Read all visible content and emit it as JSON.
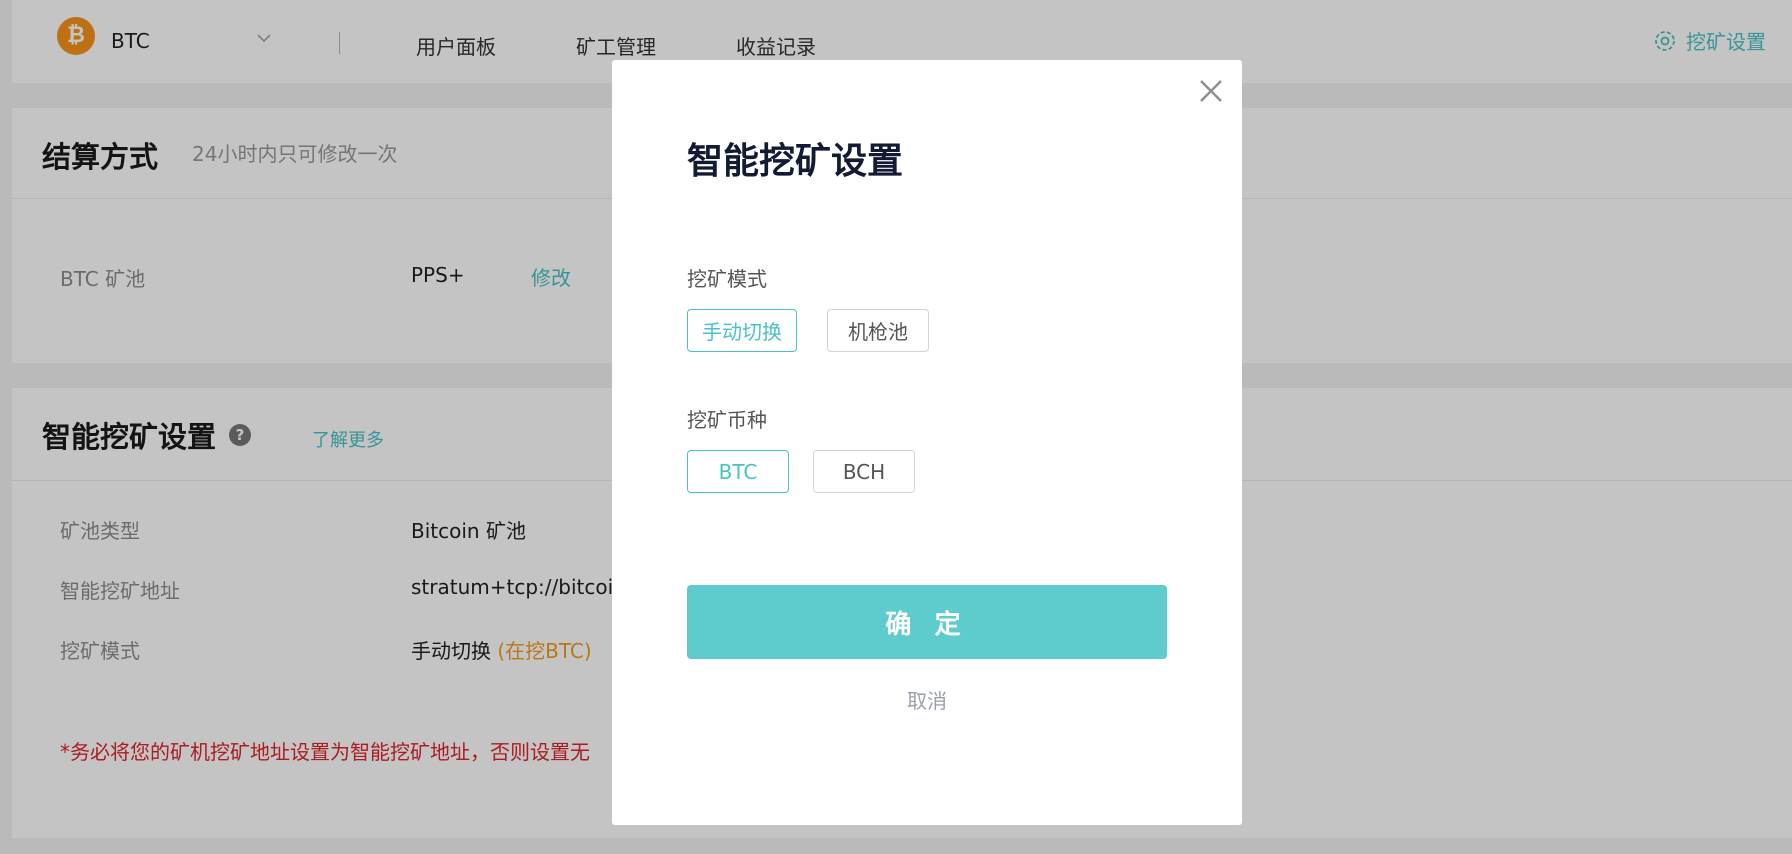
{
  "header": {
    "coin": "BTC",
    "nav": [
      "用户面板",
      "矿工管理",
      "收益记录"
    ],
    "settings_label": "挖矿设置"
  },
  "settlement": {
    "title": "结算方式",
    "note": "24小时内只可修改一次",
    "pool_label": "BTC 矿池",
    "pool_value": "PPS+",
    "edit_label": "修改"
  },
  "smart": {
    "title": "智能挖矿设置",
    "help": "?",
    "learn_more": "了解更多",
    "rows": [
      {
        "label": "矿池类型",
        "value": "Bitcoin 矿池"
      },
      {
        "label": "智能挖矿地址",
        "value": "stratum+tcp://bitcoin."
      },
      {
        "label": "挖矿模式",
        "value": "手动切换",
        "extra": "(在挖BTC)"
      }
    ],
    "warning": "*务必将您的矿机挖矿地址设置为智能挖矿地址，否则设置无"
  },
  "modal": {
    "title": "智能挖矿设置",
    "mode_label": "挖矿模式",
    "mode_options": [
      "手动切换",
      "机枪池"
    ],
    "mode_selected": "手动切换",
    "coin_label": "挖矿币种",
    "coin_options": [
      "BTC",
      "BCH"
    ],
    "coin_selected": "BTC",
    "confirm": "确 定",
    "cancel": "取消"
  },
  "colors": {
    "accent": "#49c2c5",
    "warning": "#e0252c",
    "mining_status": "#f39b1f"
  }
}
